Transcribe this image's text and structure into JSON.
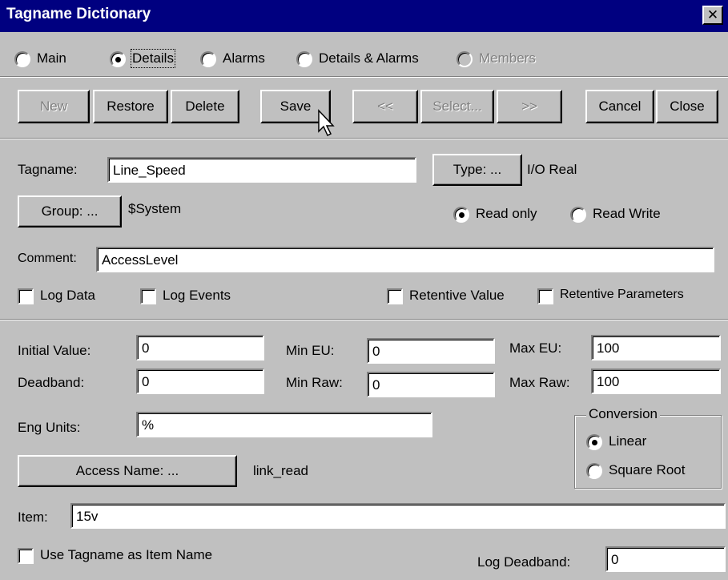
{
  "window": {
    "title": "Tagname Dictionary",
    "close_glyph": "✕"
  },
  "view_options": [
    {
      "label": "Main",
      "checked": false,
      "enabled": true
    },
    {
      "label": "Details",
      "checked": true,
      "enabled": true
    },
    {
      "label": "Alarms",
      "checked": false,
      "enabled": true
    },
    {
      "label": "Details & Alarms",
      "checked": false,
      "enabled": true
    },
    {
      "label": "Members",
      "checked": false,
      "enabled": false
    }
  ],
  "toolbar": {
    "new": "New",
    "restore": "Restore",
    "delete": "Delete",
    "save": "Save",
    "prev": "<<",
    "select": "Select...",
    "next": ">>",
    "cancel": "Cancel",
    "close": "Close"
  },
  "tag": {
    "tagname_label": "Tagname:",
    "tagname_value": "Line_Speed",
    "type_button": "Type: ...",
    "type_value": "I/O Real",
    "group_button": "Group: ...",
    "group_value": "$System",
    "read_only": "Read only",
    "read_write": "Read Write",
    "access_mode": "read_only",
    "comment_label": "Comment:",
    "comment_value": "AccessLevel",
    "log_data": "Log Data",
    "log_events": "Log Events",
    "retentive_value": "Retentive Value",
    "retentive_parameters": "Retentive Parameters"
  },
  "details": {
    "initial_value_label": "Initial Value:",
    "initial_value": "0",
    "deadband_label": "Deadband:",
    "deadband": "0",
    "min_eu_label": "Min EU:",
    "min_eu": "0",
    "min_raw_label": "Min Raw:",
    "min_raw": "0",
    "max_eu_label": "Max EU:",
    "max_eu": "100",
    "max_raw_label": "Max Raw:",
    "max_raw": "100",
    "eng_units_label": "Eng Units:",
    "eng_units": "%",
    "conversion_title": "Conversion",
    "conversion_linear": "Linear",
    "conversion_square_root": "Square Root",
    "conversion_selected": "linear",
    "access_name_button": "Access Name: ...",
    "access_name_value": "link_read",
    "item_label": "Item:",
    "item_value": "15v",
    "use_tagname": "Use Tagname as Item Name",
    "log_deadband_label": "Log Deadband:",
    "log_deadband": "0"
  },
  "icons": {
    "cursor": "mouse-pointer-icon"
  }
}
